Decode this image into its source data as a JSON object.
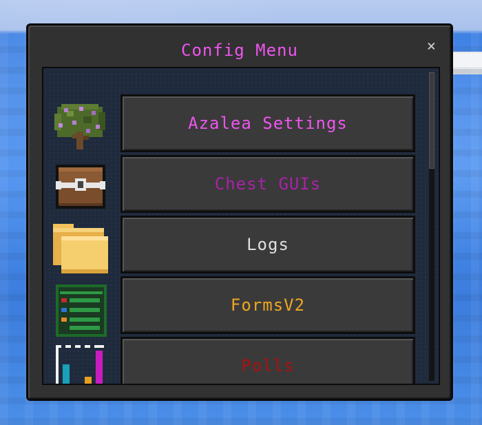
{
  "window": {
    "title": "Config Menu",
    "close_label": "×"
  },
  "menu": {
    "items": [
      {
        "label": "Azalea Settings",
        "color": "#ee55ee",
        "icon": "azalea-tree-icon"
      },
      {
        "label": "Chest GUIs",
        "color": "#aa22aa",
        "icon": "chest-icon"
      },
      {
        "label": "Logs",
        "color": "#e0e0e0",
        "icon": "folder-icon"
      },
      {
        "label": "FormsV2",
        "color": "#f0a820",
        "icon": "form-list-icon"
      },
      {
        "label": "Polls",
        "color": "#aa1111",
        "icon": "bar-chart-icon"
      }
    ]
  }
}
